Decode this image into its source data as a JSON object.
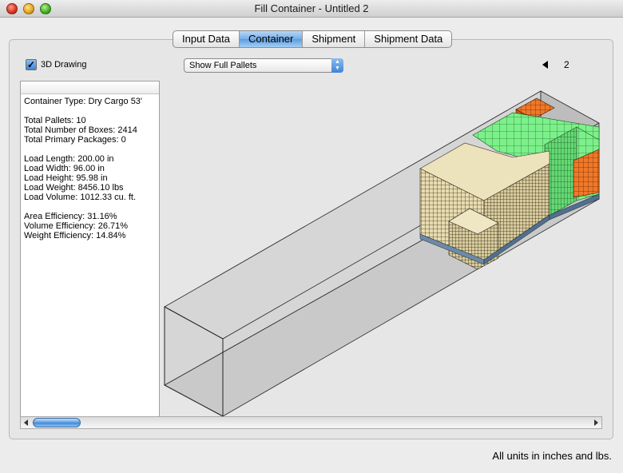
{
  "window": {
    "title": "Fill Container - Untitled 2"
  },
  "tabs": [
    {
      "label": "Input Data",
      "active": false
    },
    {
      "label": "Container",
      "active": true
    },
    {
      "label": "Shipment",
      "active": false
    },
    {
      "label": "Shipment Data",
      "active": false
    }
  ],
  "toolbar": {
    "drawing_3d_label": "3D Drawing",
    "drawing_3d_checked": true,
    "show_popup_value": "Show Full Pallets",
    "page_number": "2"
  },
  "stats": {
    "lines": [
      "Container Type: Dry Cargo 53'",
      "",
      "Total Pallets: 10",
      "Total Number of Boxes: 2414",
      "Total Primary Packages: 0",
      "",
      "Load Length: 200.00 in",
      "Load Width: 96.00 in",
      "Load Height: 95.98 in",
      "Load Weight: 8456.10 lbs",
      "Load Volume: 1012.33 cu. ft.",
      "",
      "Area Efficiency: 31.16%",
      "Volume Efficiency: 26.71%",
      "Weight Efficiency: 14.84%"
    ]
  },
  "colors": {
    "beige_box": "#e8dcb0",
    "green_box": "#7cf08a",
    "orange_box": "#f07828",
    "container_fill": "#cdcdcd",
    "accent_blue": "#5c9ce0"
  },
  "footer": {
    "units_note": "All units in inches and lbs."
  }
}
